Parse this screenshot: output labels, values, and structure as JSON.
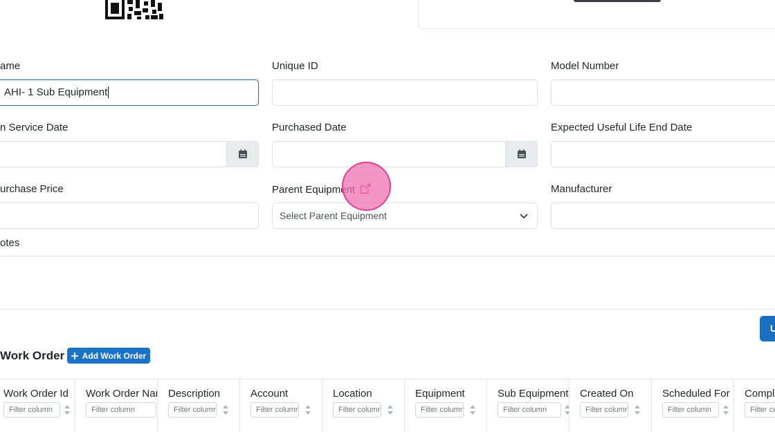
{
  "form": {
    "name": {
      "label": "ame",
      "value": "AHI- 1 Sub Equipment"
    },
    "unique_id": {
      "label": "Unique ID",
      "value": ""
    },
    "model_number": {
      "label": "Model Number",
      "value": ""
    },
    "in_service_date": {
      "label": "n Service Date",
      "value": ""
    },
    "purchased_date": {
      "label": "Purchased Date",
      "value": ""
    },
    "expected_useful_life_end_date": {
      "label": "Expected Useful Life End Date",
      "value": ""
    },
    "purchase_price": {
      "label": "urchase Price",
      "value": ""
    },
    "parent_equipment": {
      "label": "Parent Equipment",
      "placeholder": "Select Parent Equipment"
    },
    "manufacturer": {
      "label": "Manufacturer",
      "value": ""
    },
    "notes": {
      "label": "otes"
    }
  },
  "update_button_partial": "U",
  "work_order": {
    "title": "Work Order",
    "add_button": "Add Work Order",
    "columns": [
      {
        "title": "Work Order Id",
        "filter": "Filter column"
      },
      {
        "title": "Work Order Name",
        "filter": "Filter column"
      },
      {
        "title": "Description",
        "filter": "Filter column"
      },
      {
        "title": "Account",
        "filter": "Filter column"
      },
      {
        "title": "Location",
        "filter": "Filter column"
      },
      {
        "title": "Equipment",
        "filter": "Filter column"
      },
      {
        "title": "Sub Equipment",
        "filter": "Filter column"
      },
      {
        "title": "Created On",
        "filter": "Filter column"
      },
      {
        "title": "Scheduled For",
        "filter": "Filter column"
      },
      {
        "title": "Completed",
        "filter": "Filter column"
      }
    ]
  },
  "colors": {
    "accent": "#1a73c7",
    "focus_border": "#3b6e99",
    "cursor": "#f06eaf"
  },
  "icons": [
    "qr-code-icon",
    "calendar-icon",
    "external-link-icon",
    "chevron-down-icon",
    "plus-icon",
    "sort-icon"
  ]
}
